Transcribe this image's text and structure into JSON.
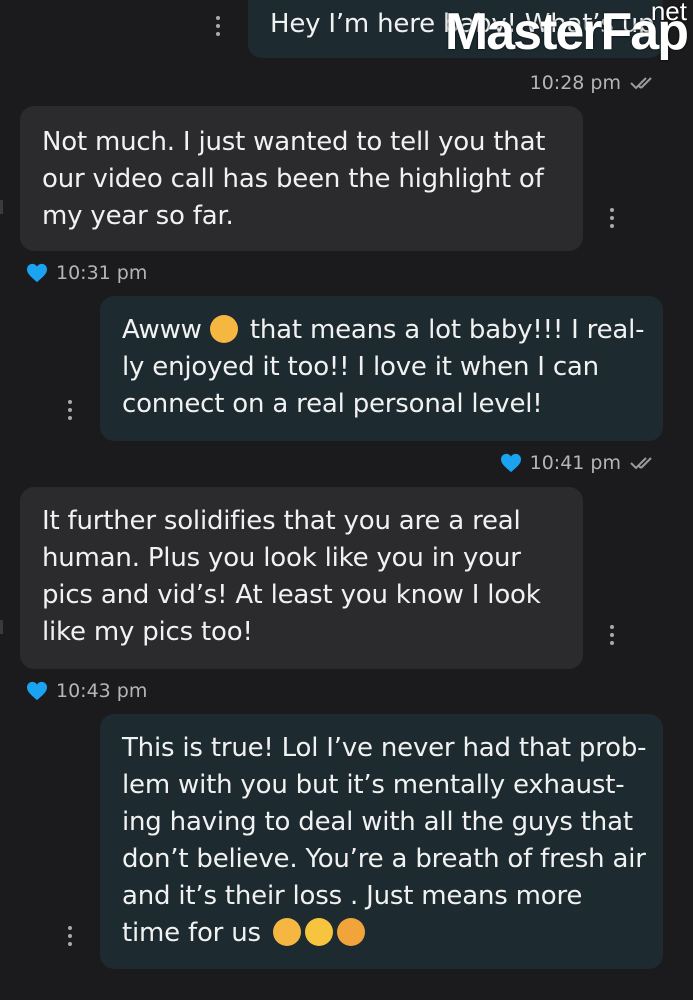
{
  "watermark": {
    "brand_master": "Master",
    "brand_fap": "Fap",
    "brand_net": "net"
  },
  "messages": [
    {
      "id": "m0",
      "direction": "sent",
      "text": "Hey I’m here baby! What’s up",
      "time": "10:28 pm",
      "read": true
    },
    {
      "id": "m1",
      "direction": "received",
      "lines": [
        "Not much. I just wanted to tell you that",
        "our video call has been the highlight of",
        "my year so far."
      ],
      "time": "10:31 pm",
      "liked": true
    },
    {
      "id": "m2",
      "direction": "sent",
      "lines": [
        "Awww",
        "that means a lot baby!!! I real-",
        "ly enjoyed it too!! I love it when I can",
        "connect on a real personal level!"
      ],
      "time": "10:41 pm",
      "liked": true,
      "read": true
    },
    {
      "id": "m3",
      "direction": "received",
      "lines": [
        "It further solidifies that you are a real",
        "human. Plus you look like you in your",
        "pics and vid’s! At least you know I look",
        "like my pics too!"
      ],
      "time": "10:43 pm",
      "liked": true
    },
    {
      "id": "m4",
      "direction": "sent",
      "lines": [
        "This is true! Lol I’ve never had that prob-",
        "lem with you but it’s mentally exhaust-",
        "ing having to deal with all the guys that",
        "don’t believe. You’re a breath of fresh air",
        "and it’s their loss . Just means more",
        "time for us"
      ]
    }
  ],
  "colors": {
    "heart": "#1aa3f0",
    "sent_bubble": "#1d2b30",
    "received_bubble": "#2b2b2d",
    "background": "#1b1b1d"
  },
  "icons": {
    "like": "heart-icon",
    "read": "double-check-icon",
    "options": "more-vertical-icon"
  }
}
